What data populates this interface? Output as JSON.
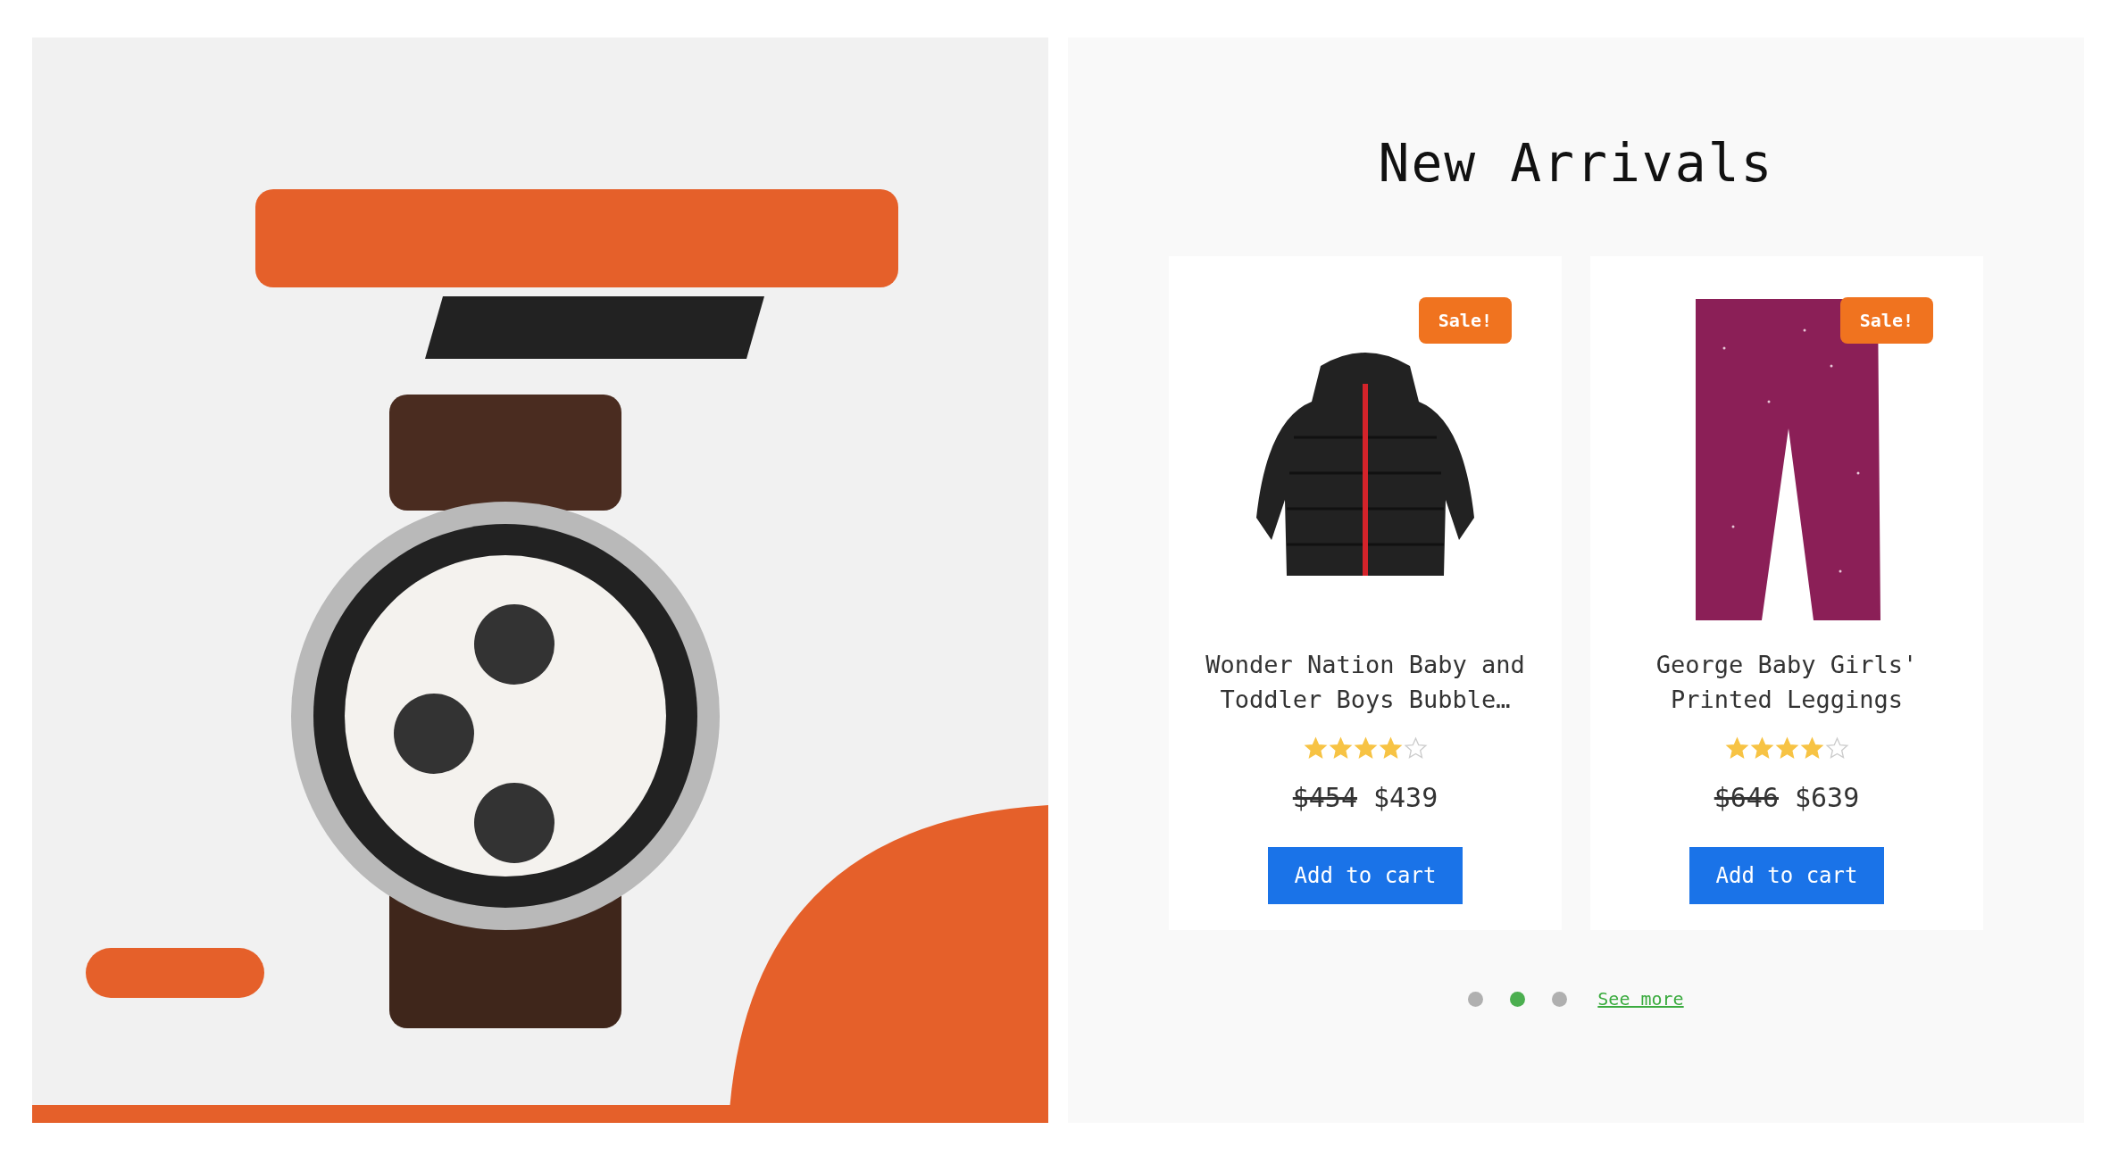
{
  "section_title": "New Arrivals",
  "products": [
    {
      "name": "Wonder Nation Baby and Toddler Boys Bubble…",
      "badge": "Sale!",
      "stars": 4,
      "old_price": "$454",
      "price": "$439",
      "button": "Add to cart"
    },
    {
      "name": "George Baby Girls' Printed Leggings",
      "badge": "Sale!",
      "stars": 4,
      "old_price": "$646",
      "price": "$639",
      "button": "Add to cart"
    }
  ],
  "carousel_dots": [
    {
      "selected": false
    },
    {
      "selected": true
    },
    {
      "selected": false
    }
  ],
  "see_more": "See more"
}
